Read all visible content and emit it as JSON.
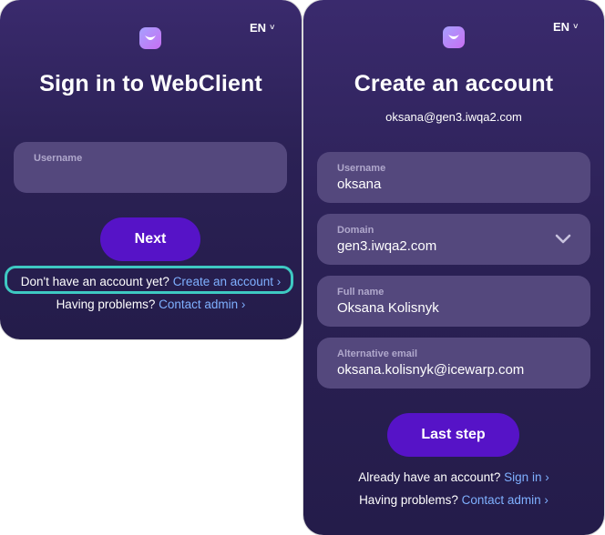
{
  "signin": {
    "lang": "EN",
    "title": "Sign in to WebClient",
    "username_label": "Username",
    "next_label": "Next",
    "no_account_text": "Don't have an account yet?",
    "create_account_link": "Create an account ›",
    "problems_text": "Having problems?",
    "contact_admin_link": "Contact admin ›"
  },
  "signup": {
    "lang": "EN",
    "title": "Create an account",
    "email": "oksana@gen3.iwqa2.com",
    "fields": [
      {
        "label": "Username",
        "value": "oksana"
      },
      {
        "label": "Domain",
        "value": "gen3.iwqa2.com"
      },
      {
        "label": "Full name",
        "value": "Oksana Kolisnyk"
      },
      {
        "label": "Alternative email",
        "value": "oksana.kolisnyk@icewarp.com"
      }
    ],
    "submit_label": "Last step",
    "have_account_text": "Already have an account?",
    "signin_link": "Sign in ›",
    "problems_text": "Having problems?",
    "contact_admin_link": "Contact admin ›"
  },
  "icons": {
    "logo": "app-logo-icon",
    "lang_chevron": "chevron-down-icon",
    "domain_chevron": "chevron-down-icon"
  },
  "colors": {
    "panel_bg": "#2b2155",
    "field_bg": "#54487d",
    "button": "#5613c7",
    "link": "#7fb0ff",
    "highlight": "#3ec9c2",
    "logo": "#b58af5"
  }
}
